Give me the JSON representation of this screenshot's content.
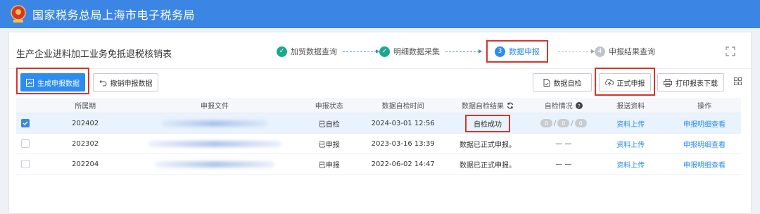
{
  "header": {
    "title": "国家税务总局上海市电子税务局"
  },
  "page": {
    "title": "生产企业进料加工业务免抵退税核销表"
  },
  "steps": [
    {
      "num": "1",
      "label": "加贸数据查询",
      "state": "done"
    },
    {
      "num": "2",
      "label": "明细数据采集",
      "state": "done"
    },
    {
      "num": "3",
      "label": "数据申报",
      "state": "active"
    },
    {
      "num": "4",
      "label": "申报结果查询",
      "state": "todo"
    }
  ],
  "toolbar": {
    "generate": "生成申报数据",
    "revoke": "撤销申报数据",
    "self_check": "数据自检",
    "formal": "正式申报",
    "print": "打印报表下载"
  },
  "table": {
    "headers": [
      "所属期",
      "申报文件",
      "申报状态",
      "数据自检时间",
      "数据自检结果",
      "自检情况",
      "报送资料",
      "操作"
    ],
    "rows": [
      {
        "period": "202402",
        "status": "已自检",
        "time": "2024-03-01 12:56",
        "result": "自检成功",
        "check": [
          "0",
          "0",
          "0"
        ],
        "upload": "资料上传",
        "action": "申报明细查看",
        "checked": true
      },
      {
        "period": "202302",
        "status": "已申报",
        "time": "2023-03-16 13:39",
        "result": "数据已正式申报。",
        "check_text": "— —",
        "upload": "资料上传",
        "action": "申报明细查看",
        "checked": false
      },
      {
        "period": "202204",
        "status": "已申报",
        "time": "2022-06-02 14:47",
        "result": "数据已正式申报。",
        "check_text": "— —",
        "upload": "资料上传",
        "action": "申报明细查看",
        "checked": false
      }
    ]
  }
}
